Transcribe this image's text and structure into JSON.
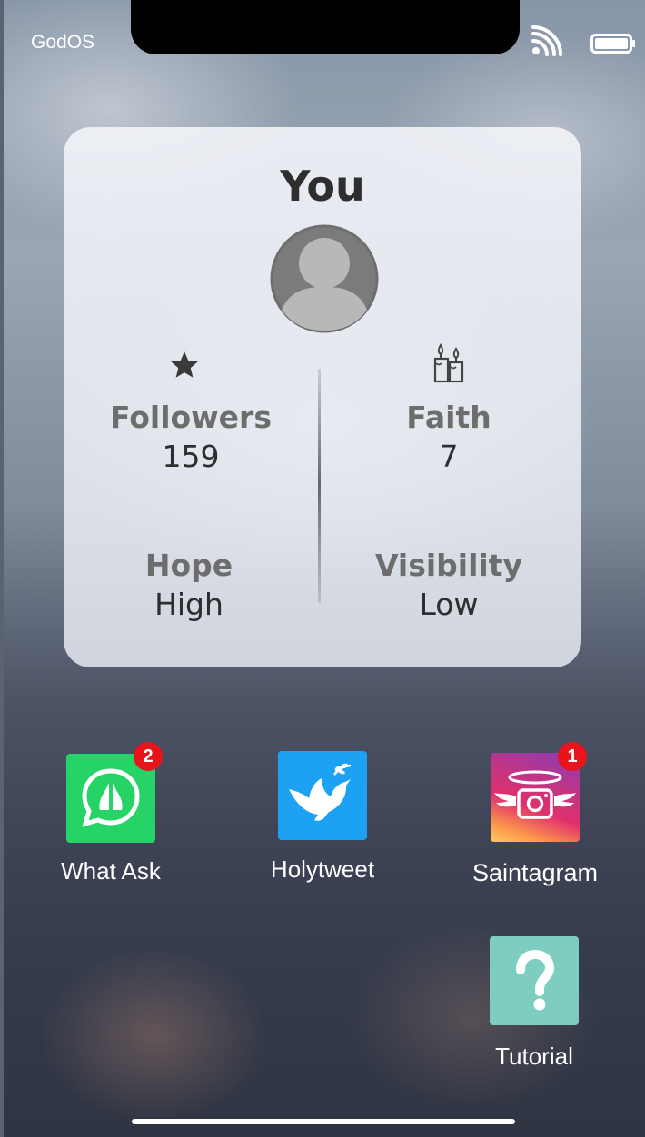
{
  "status_bar": {
    "carrier": "GodOS",
    "wifi_icon": "wifi-icon",
    "battery_icon": "battery-icon"
  },
  "profile_card": {
    "title": "You",
    "avatar_icon": "user-avatar-icon",
    "stats": {
      "followers": {
        "icon": "star-icon",
        "label": "Followers",
        "value": "159"
      },
      "faith": {
        "icon": "candles-icon",
        "label": "Faith",
        "value": "7"
      },
      "hope": {
        "label": "Hope",
        "value": "High"
      },
      "visibility": {
        "label": "Visibility",
        "value": "Low"
      }
    }
  },
  "apps": [
    {
      "label": "What Ask",
      "icon": "praying-hands-chat-icon",
      "badge": "2",
      "color": "#25d366"
    },
    {
      "label": "Holytweet",
      "icon": "dove-icon",
      "badge": "",
      "color": "#1da1f2"
    },
    {
      "label": "Saintagram",
      "icon": "halo-camera-icon",
      "badge": "1",
      "color": "#c13584"
    },
    {
      "label": "Tutorial",
      "icon": "question-mark-icon",
      "badge": "",
      "color": "#7ecdc0"
    }
  ]
}
